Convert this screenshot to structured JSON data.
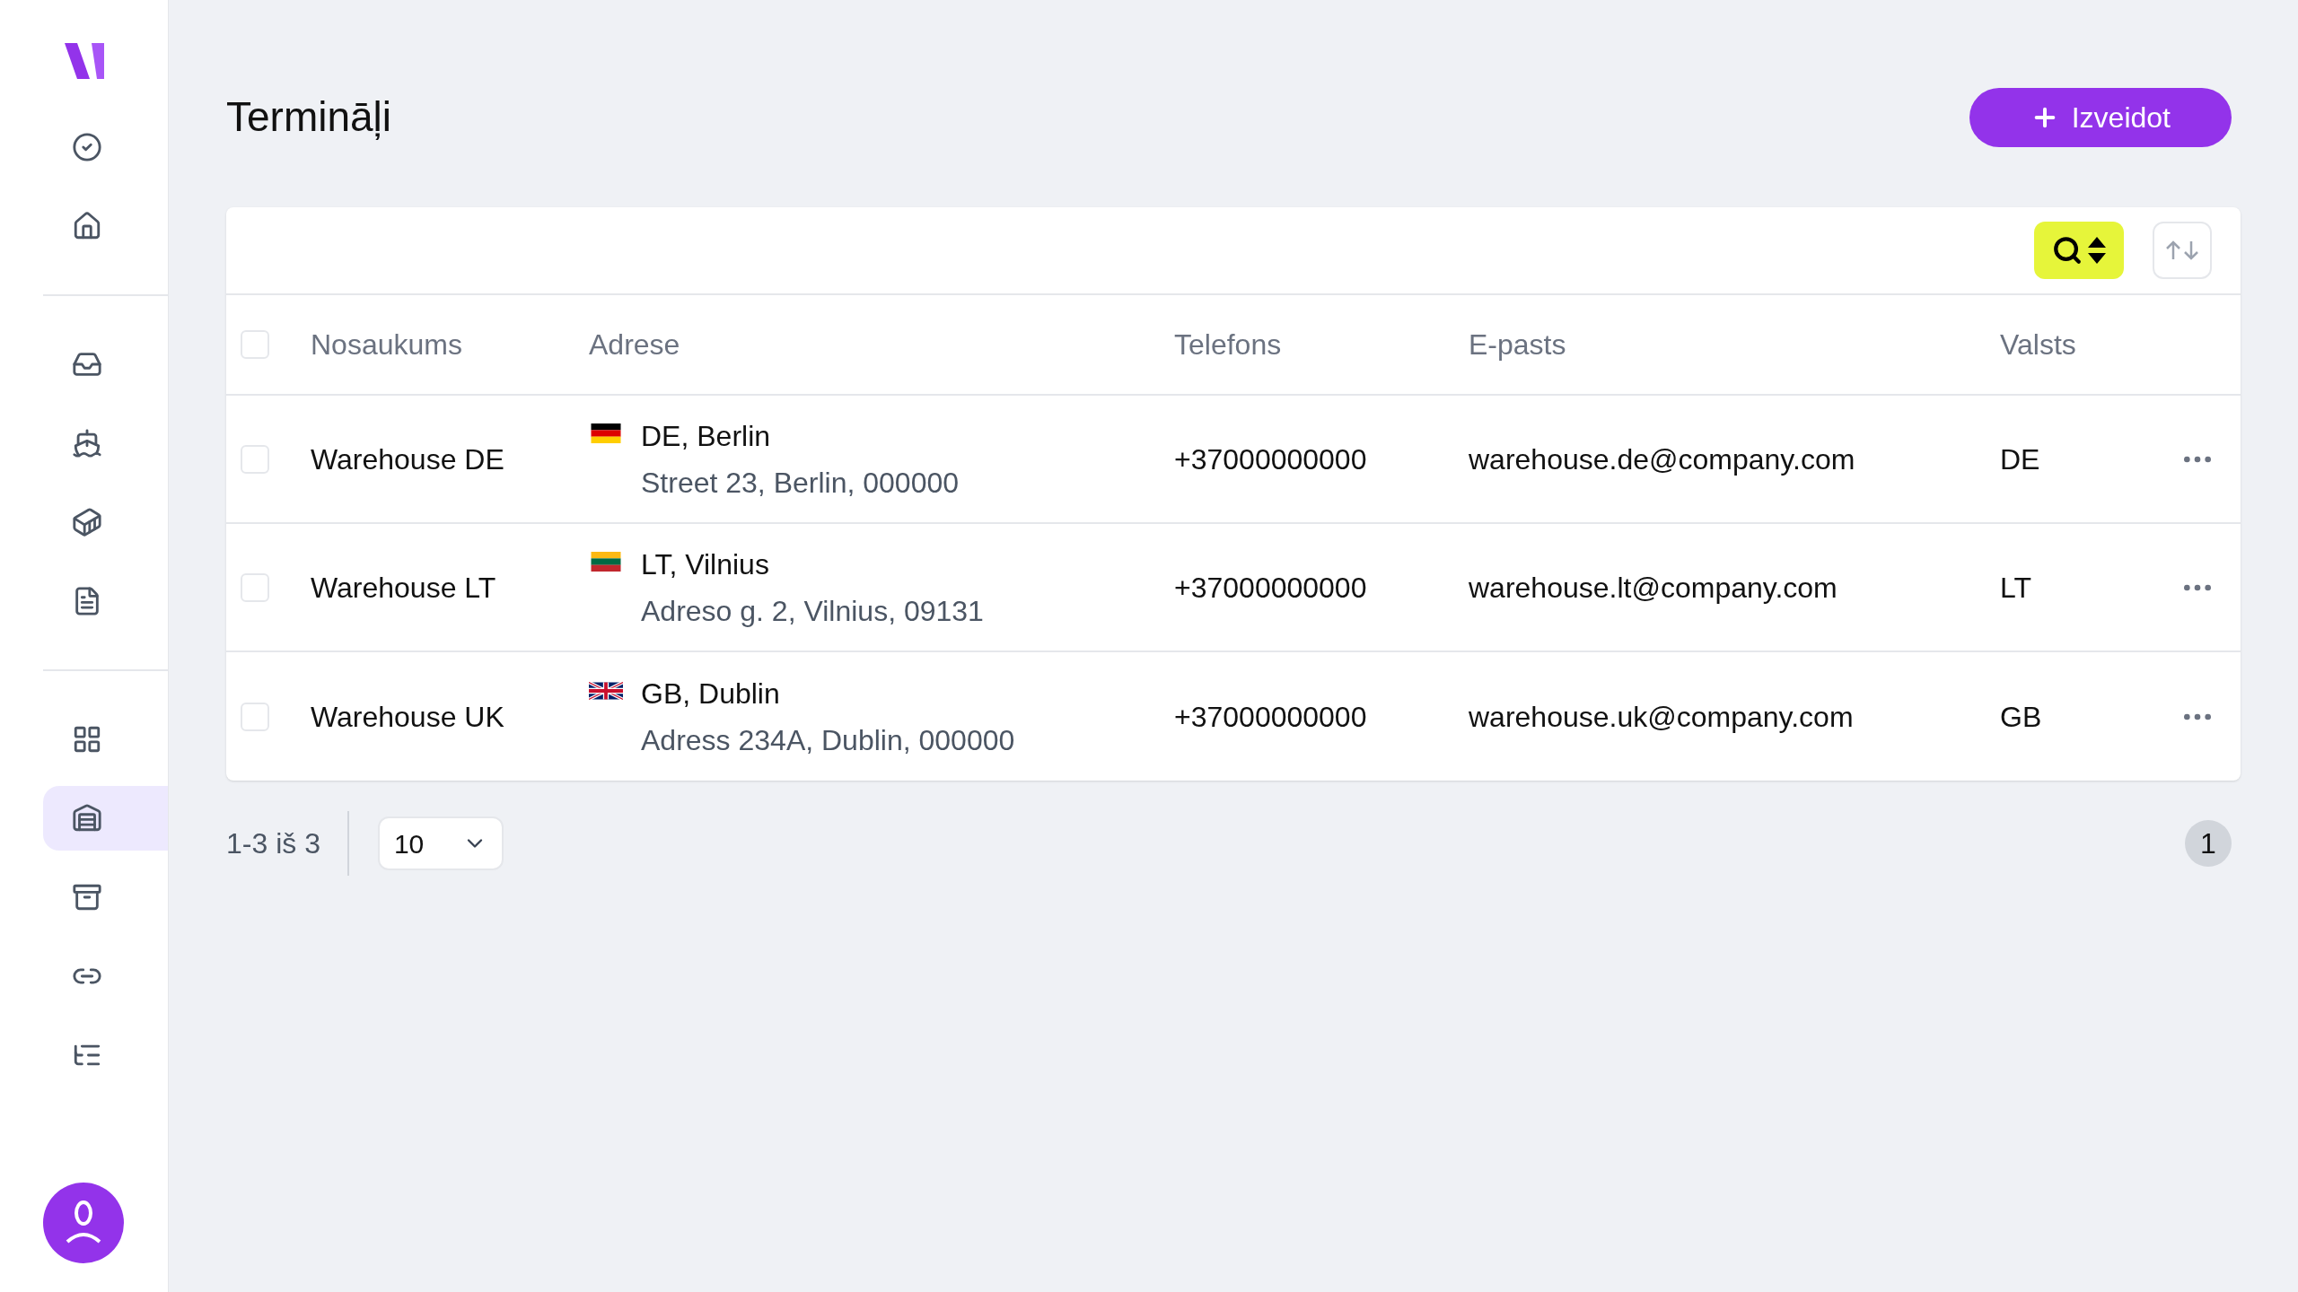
{
  "sidebar": {
    "groups": [
      [
        {
          "selected": false
        },
        {
          "selected": false
        }
      ],
      [
        {
          "selected": false
        },
        {
          "selected": false
        },
        {
          "selected": false
        },
        {
          "selected": false
        }
      ],
      [
        {
          "selected": false
        },
        {
          "selected": true
        },
        {
          "selected": false
        },
        {
          "selected": false
        },
        {
          "selected": false
        }
      ]
    ]
  },
  "page": {
    "title": "Termināļi",
    "create_button": "Izveidot"
  },
  "table": {
    "select_all": {
      "checked": false
    },
    "columns": [
      "Nosaukums",
      "Adrese",
      "Telefons",
      "E-pasts",
      "Valsts"
    ],
    "rows": [
      {
        "checked": false,
        "name": "Warehouse DE",
        "address": {
          "kind": "de",
          "title": "DE, Berlin",
          "line": "Street 23, Berlin, 000000"
        },
        "phone": "+37000000000",
        "email": "warehouse.de@company.com",
        "country": "DE"
      },
      {
        "checked": false,
        "name": "Warehouse LT",
        "address": {
          "kind": "lt",
          "title": "LT, Vilnius",
          "line": "Adreso g. 2, Vilnius, 09131"
        },
        "phone": "+37000000000",
        "email": "warehouse.lt@company.com",
        "country": "LT"
      },
      {
        "checked": false,
        "name": "Warehouse UK",
        "address": {
          "kind": "gb",
          "title": "GB, Dublin",
          "line": "Adress 234A, Dublin, 000000"
        },
        "phone": "+37000000000",
        "email": "warehouse.uk@company.com",
        "country": "GB"
      }
    ]
  },
  "pagination": {
    "range": "1-3 iš 3",
    "page_size": "10",
    "pages": [
      {
        "label": "1",
        "selected": true
      }
    ]
  }
}
